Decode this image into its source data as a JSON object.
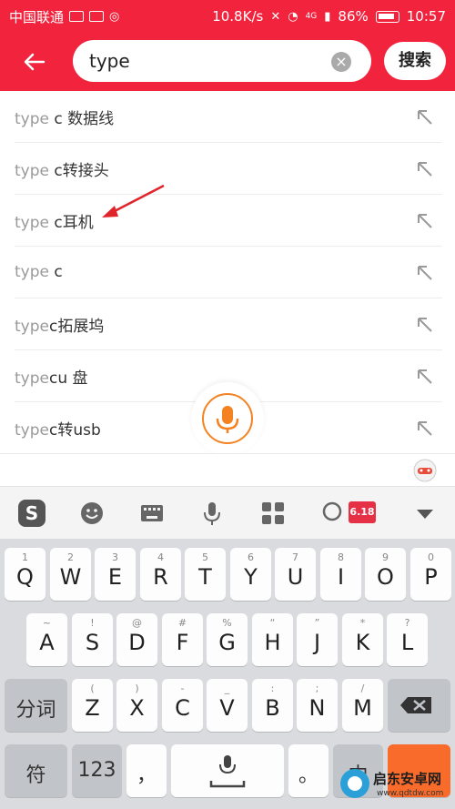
{
  "status_bar": {
    "carrier": "中国联通",
    "speed": "10.8K/s",
    "network": "4G",
    "battery": "86%",
    "time": "10:57"
  },
  "search": {
    "value": "type",
    "button": "搜索"
  },
  "suggestions": [
    {
      "prefix": "type",
      "rest": " c 数据线"
    },
    {
      "prefix": "type",
      "rest": " c转接头"
    },
    {
      "prefix": "type",
      "rest": " c耳机"
    },
    {
      "prefix": "type",
      "rest": " c"
    },
    {
      "prefix": "type",
      "rest": "c拓展坞"
    },
    {
      "prefix": "type",
      "rest": "cu 盘"
    },
    {
      "prefix": "type",
      "rest": "c转usb"
    }
  ],
  "toolbar": {
    "promo_label": "6.18"
  },
  "keyboard": {
    "row1": [
      {
        "k": "Q",
        "s": "1"
      },
      {
        "k": "W",
        "s": "2"
      },
      {
        "k": "E",
        "s": "3"
      },
      {
        "k": "R",
        "s": "4"
      },
      {
        "k": "T",
        "s": "5"
      },
      {
        "k": "Y",
        "s": "6"
      },
      {
        "k": "U",
        "s": "7"
      },
      {
        "k": "I",
        "s": "8"
      },
      {
        "k": "O",
        "s": "9"
      },
      {
        "k": "P",
        "s": "0"
      }
    ],
    "row2": [
      {
        "k": "A",
        "s": "~"
      },
      {
        "k": "S",
        "s": "!"
      },
      {
        "k": "D",
        "s": "@"
      },
      {
        "k": "F",
        "s": "#"
      },
      {
        "k": "G",
        "s": "%"
      },
      {
        "k": "H",
        "s": "“"
      },
      {
        "k": "J",
        "s": "”"
      },
      {
        "k": "K",
        "s": "*"
      },
      {
        "k": "L",
        "s": "?"
      }
    ],
    "row3_left": "分词",
    "row3": [
      {
        "k": "Z",
        "s": "("
      },
      {
        "k": "X",
        "s": ")"
      },
      {
        "k": "C",
        "s": "-"
      },
      {
        "k": "V",
        "s": "_"
      },
      {
        "k": "B",
        "s": ":"
      },
      {
        "k": "N",
        "s": ";"
      },
      {
        "k": "M",
        "s": "/"
      }
    ],
    "row4": {
      "symbol": "符",
      "numbers": "123",
      "comma": "，",
      "period": "。",
      "lang": "中"
    }
  },
  "watermark": {
    "title": "启东安卓网",
    "url": "www.qdtdw.com"
  },
  "colors": {
    "brand_red": "#f2233d",
    "mic_orange": "#f58220",
    "annotation_red": "#e0242b"
  }
}
